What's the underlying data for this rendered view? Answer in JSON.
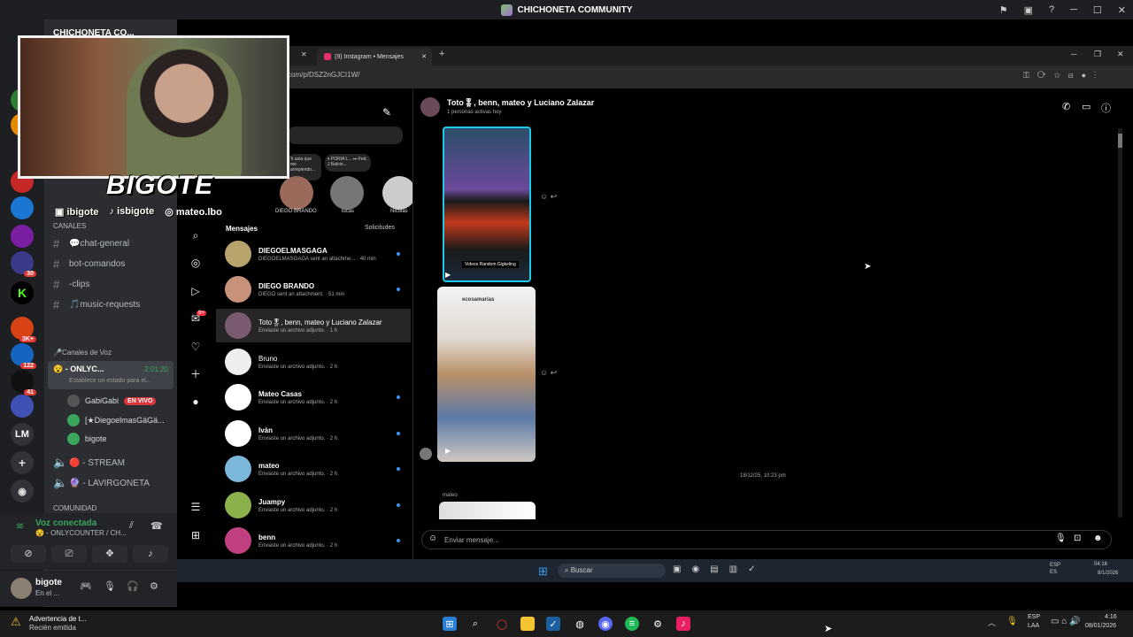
{
  "window": {
    "title": "CHICHONETA COMMUNITY"
  },
  "discord": {
    "server_header": "CHICHONETA CO...",
    "channels_section": "CANALES",
    "text_channels": [
      {
        "label": "💬chat-general"
      },
      {
        "label": "bot-comandos"
      },
      {
        "label": "-clips"
      },
      {
        "label": "🎵music-requests"
      }
    ],
    "voice_section": "🎤Canales de Voz",
    "active_voice": {
      "label": "😵 - ONLYC...",
      "timer": "2:01:20",
      "status": "Establece un estado para el..."
    },
    "voice_users": [
      {
        "name": "GabiGabi",
        "live": "EN VIVO"
      },
      {
        "name": "[★DiegoelmasGäGä..."
      },
      {
        "name": "bigote"
      }
    ],
    "other_voice": [
      {
        "label": "🔴 - STREAM"
      },
      {
        "label": "🔮 - LAVIRGONETA"
      }
    ],
    "community_section": "COMUNIDAD",
    "voice_connected": {
      "title": "Voz conectada",
      "channel": "😵 - ONLYCOUNTER / CH..."
    },
    "user": {
      "name": "bigote",
      "status": "En el ..."
    },
    "server_badges": [
      "3K+",
      "30",
      "122",
      "41"
    ],
    "server_letters": [
      "K",
      "LM"
    ]
  },
  "overlay": {
    "logo": "BIGOTE",
    "socials": [
      {
        "label": "ibigote"
      },
      {
        "label": "isbigote"
      },
      {
        "label": "mateo.lbo"
      }
    ]
  },
  "browser": {
    "tab_label": "(9) Instagram • Mensajes",
    "url": "com/p/DSZ2nGJCI1W/"
  },
  "instagram": {
    "messages_label": "Mensajes",
    "requests_label": "Solicitudes",
    "notes": [
      {
        "text": "'k asta que me arrepiendo..."
      },
      {
        "text": "⏸ PORIA L... ⏭ Fed, J Balvin..."
      }
    ],
    "story_names": [
      "DIEGO BRANDO",
      "lucas",
      "Nicolas"
    ],
    "dms": [
      {
        "name": "DIEGOELMASGAGA",
        "preview": "DIEGOELMASGAGA sent an attachme... · 40 min"
      },
      {
        "name": "DIEGO BRANDO",
        "preview": "DIEGO sent an attachment. · 51 min"
      },
      {
        "name": "Toto🎖, benn, mateo y Luciano Zalazar",
        "preview": "Enviaste un archivo adjunto. · 1 h"
      },
      {
        "name": "Bruno",
        "preview": "Enviaste un archivo adjunto. · 2 h"
      },
      {
        "name": "Mateo Casas",
        "preview": "Enviaste un archivo adjunto. · 2 h"
      },
      {
        "name": "Iván",
        "preview": "Enviaste un archivo adjunto. · 2 h"
      },
      {
        "name": "mateo",
        "preview": "Enviaste un archivo adjunto. · 2 h"
      },
      {
        "name": "Juampy",
        "preview": "Enviaste un archivo adjunto. · 2 h"
      },
      {
        "name": "benn",
        "preview": "Enviaste un archivo adjunto. · 2 h"
      }
    ],
    "nav_badge": "9+",
    "conversation": {
      "title": "Toto🎖, benn, mateo y Luciano Zalazar",
      "subtitle": "1 personas activas hoy",
      "video_caption": "Videos Random Gigkeling",
      "reel_user": "ecosamarias",
      "timestamp": "18/12/25, 10:23 pm",
      "last_sender": "mateo",
      "input_placeholder": "Enviar mensaje..."
    }
  },
  "inner_taskbar": {
    "search": "Buscar",
    "lang": "ESP\nES",
    "time": "04:16",
    "date": "8/1/2026"
  },
  "taskbar": {
    "notification_title": "Advertencia de t...",
    "notification_sub": "Recién emitida",
    "lang_top": "ESP",
    "lang_bottom": "LAA",
    "time": "4:16",
    "date": "08/01/2026"
  }
}
